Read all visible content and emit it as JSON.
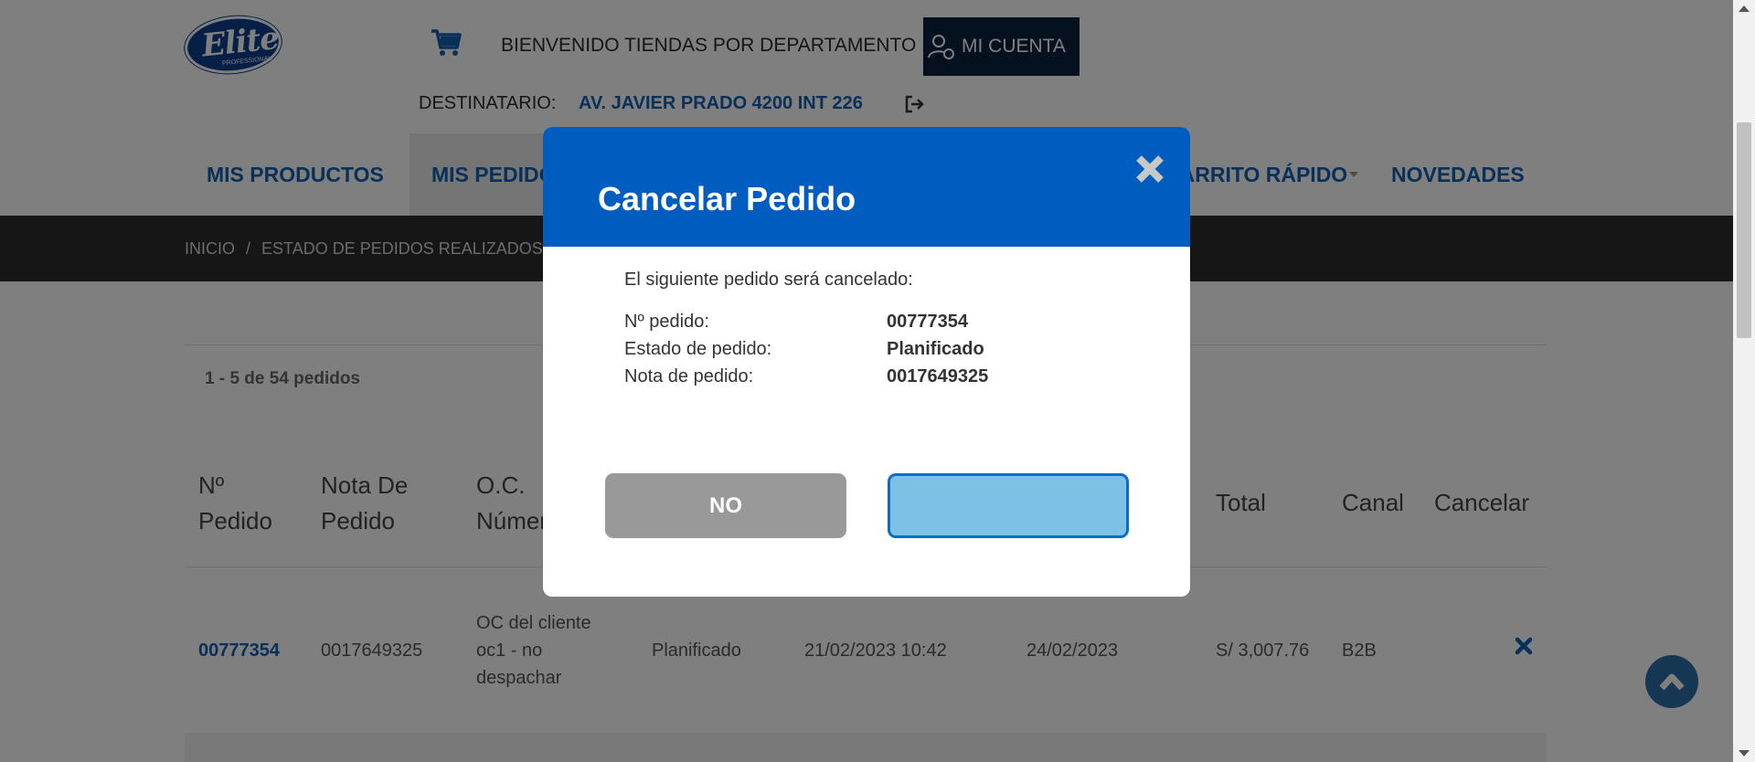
{
  "header": {
    "logo_text": "Elite",
    "logo_sub": "PROFESSIONAL",
    "welcome": "BIENVENIDO TIENDAS POR DEPARTAMENTO",
    "account_label": "MI CUENTA",
    "destinatario_label": "DESTINATARIO:",
    "destinatario_value": "AV. JAVIER PRADO 4200 INT 226"
  },
  "nav": {
    "items": [
      {
        "label": "MIS PRODUCTOS"
      },
      {
        "label": "MIS PEDIDOS"
      },
      {
        "label": "CARRITO RÁPIDO"
      },
      {
        "label": "NOVEDADES"
      }
    ]
  },
  "breadcrumb": {
    "home": "INICIO",
    "separator": "/",
    "current": "ESTADO DE PEDIDOS REALIZADOS"
  },
  "results": {
    "summary": "1 - 5 de 54 pedidos"
  },
  "table": {
    "headers": {
      "pedido_line1": "Nº",
      "pedido_line2": "Pedido",
      "nota_line1": "Nota De",
      "nota_line2": "Pedido",
      "oc_line1": "O.C.",
      "oc_line2": "Número",
      "total": "Total",
      "canal": "Canal",
      "cancelar": "Cancelar"
    },
    "rows": [
      {
        "pedido": "00777354",
        "nota": "0017649325",
        "oc_line1": "OC del cliente",
        "oc_line2": "oc1 - no",
        "oc_line3": "despachar",
        "estado": "Planificado",
        "fecha": "21/02/2023 10:42",
        "entrega": "24/02/2023",
        "total": "S/ 3,007.76",
        "canal": "B2B"
      }
    ]
  },
  "modal": {
    "title": "Cancelar Pedido",
    "intro": "El siguiente pedido será cancelado:",
    "fields": [
      {
        "label": "Nº pedido:",
        "value": "00777354"
      },
      {
        "label": "Estado de pedido:",
        "value": "Planificado"
      },
      {
        "label": "Nota de pedido:",
        "value": "0017649325"
      }
    ],
    "no_label": "NO",
    "yes_label": ""
  },
  "colors": {
    "brand_blue": "#005dc0",
    "link_blue": "#1160b0",
    "dark_nav": "#2c2c2e",
    "account_bg": "#0d2341",
    "btn_no": "#999999",
    "btn_yes": "#7ec1e7"
  }
}
